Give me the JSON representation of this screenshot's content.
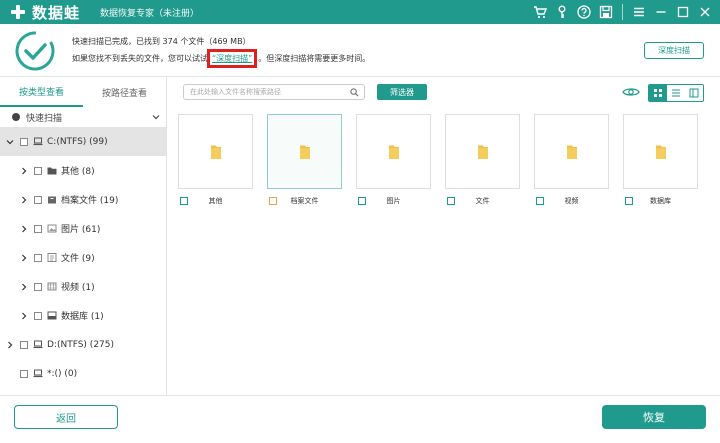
{
  "window": {
    "brand_name": "数据蛙",
    "subtitle": "数据恢复专家（未注册）"
  },
  "header": {
    "line1": "快速扫描已完成，已找到 374 个文件（469 MB）",
    "line2_before": "如果您找不到丢失的文件，您可以试试",
    "line2_link": "“深度扫描”",
    "line2_after": "。但深度扫描将需要更多时间。",
    "deep_scan_button": "深度扫描"
  },
  "sidebar": {
    "tabs": [
      {
        "label": "按类型查看",
        "active": true
      },
      {
        "label": "按路径查看",
        "active": false
      }
    ],
    "scan_type": "快速扫描",
    "tree": [
      {
        "label": "C:(NTFS) (99)",
        "icon": "drive-icon",
        "level": 0,
        "expanded": true,
        "selected": true
      },
      {
        "label": "其他 (8)",
        "icon": "folder-icon",
        "level": 1
      },
      {
        "label": "档案文件 (19)",
        "icon": "archive-icon",
        "level": 1
      },
      {
        "label": "图片 (61)",
        "icon": "image-icon",
        "level": 1
      },
      {
        "label": "文件 (9)",
        "icon": "document-icon",
        "level": 1
      },
      {
        "label": "视频 (1)",
        "icon": "video-icon",
        "level": 1
      },
      {
        "label": "数据库 (1)",
        "icon": "database-icon",
        "level": 1
      },
      {
        "label": "D:(NTFS) (275)",
        "icon": "drive-icon",
        "level": 0
      },
      {
        "label": "*:() (0)",
        "icon": "drive-icon",
        "level": 0,
        "no_arrow": true
      }
    ]
  },
  "toolbar": {
    "search_placeholder": "在此处输入文件名称搜索路径",
    "filter_button": "筛选器"
  },
  "grid": {
    "items": [
      {
        "label": "其他"
      },
      {
        "label": "档案文件",
        "highlight": true
      },
      {
        "label": "图片"
      },
      {
        "label": "文件"
      },
      {
        "label": "视频"
      },
      {
        "label": "数据库"
      }
    ]
  },
  "footer": {
    "back_button": "返回",
    "recover_button": "恢复"
  },
  "colors": {
    "accent": "#1f9a8c",
    "highlight_box": "#e02020",
    "folder": "#f0c04a"
  }
}
